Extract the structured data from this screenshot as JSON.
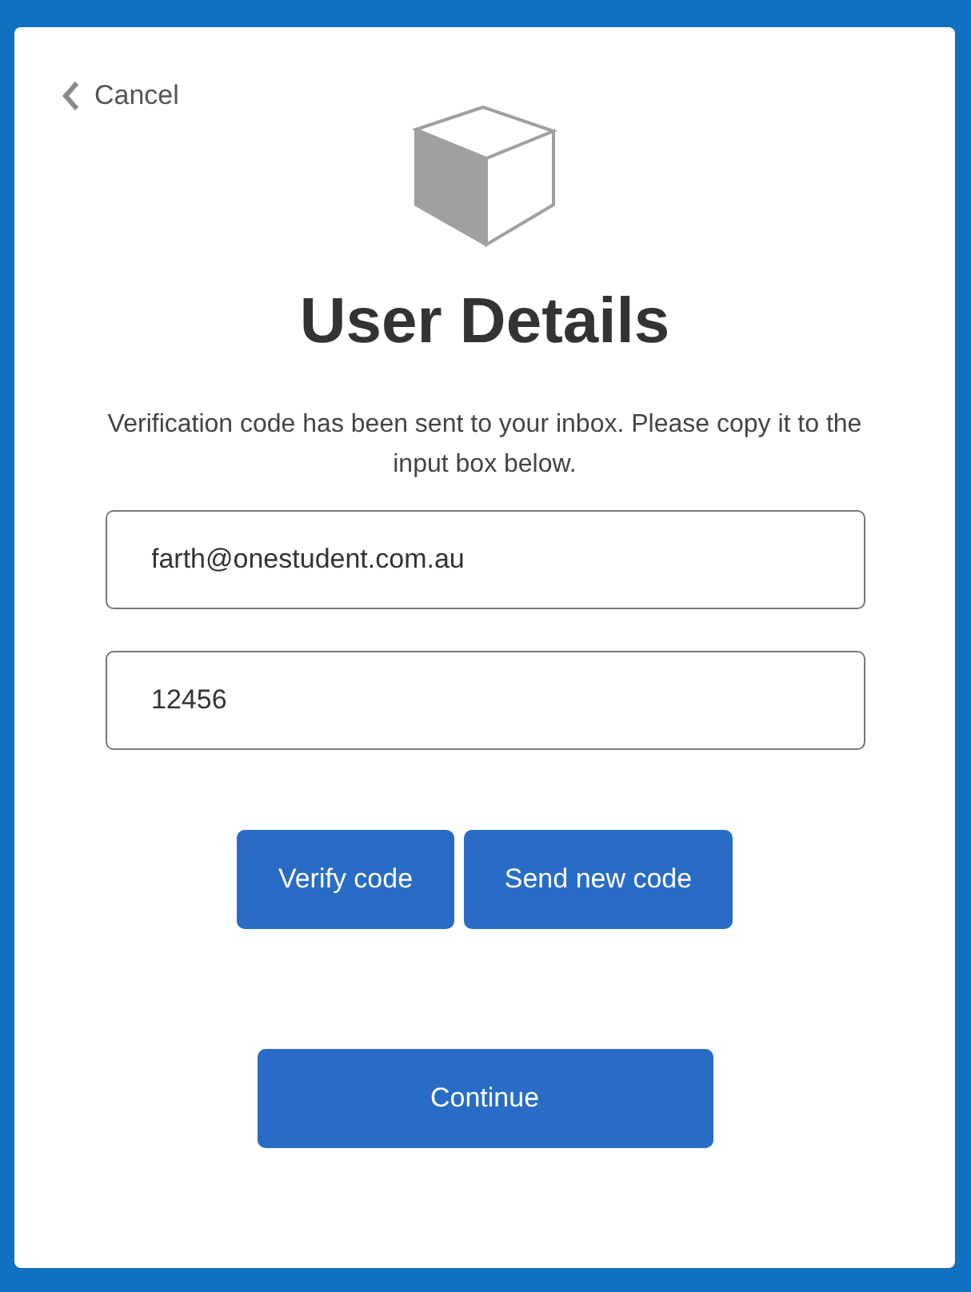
{
  "cancel": "Cancel",
  "title": "User Details",
  "message": "Verification code has been sent to your inbox. Please copy it to the input box below.",
  "fields": [
    {
      "value": "farth@onestudent.com.au"
    },
    {
      "value": "12456"
    }
  ],
  "buttons": [
    "Verify code",
    "Send new code"
  ],
  "continue": "Continue"
}
